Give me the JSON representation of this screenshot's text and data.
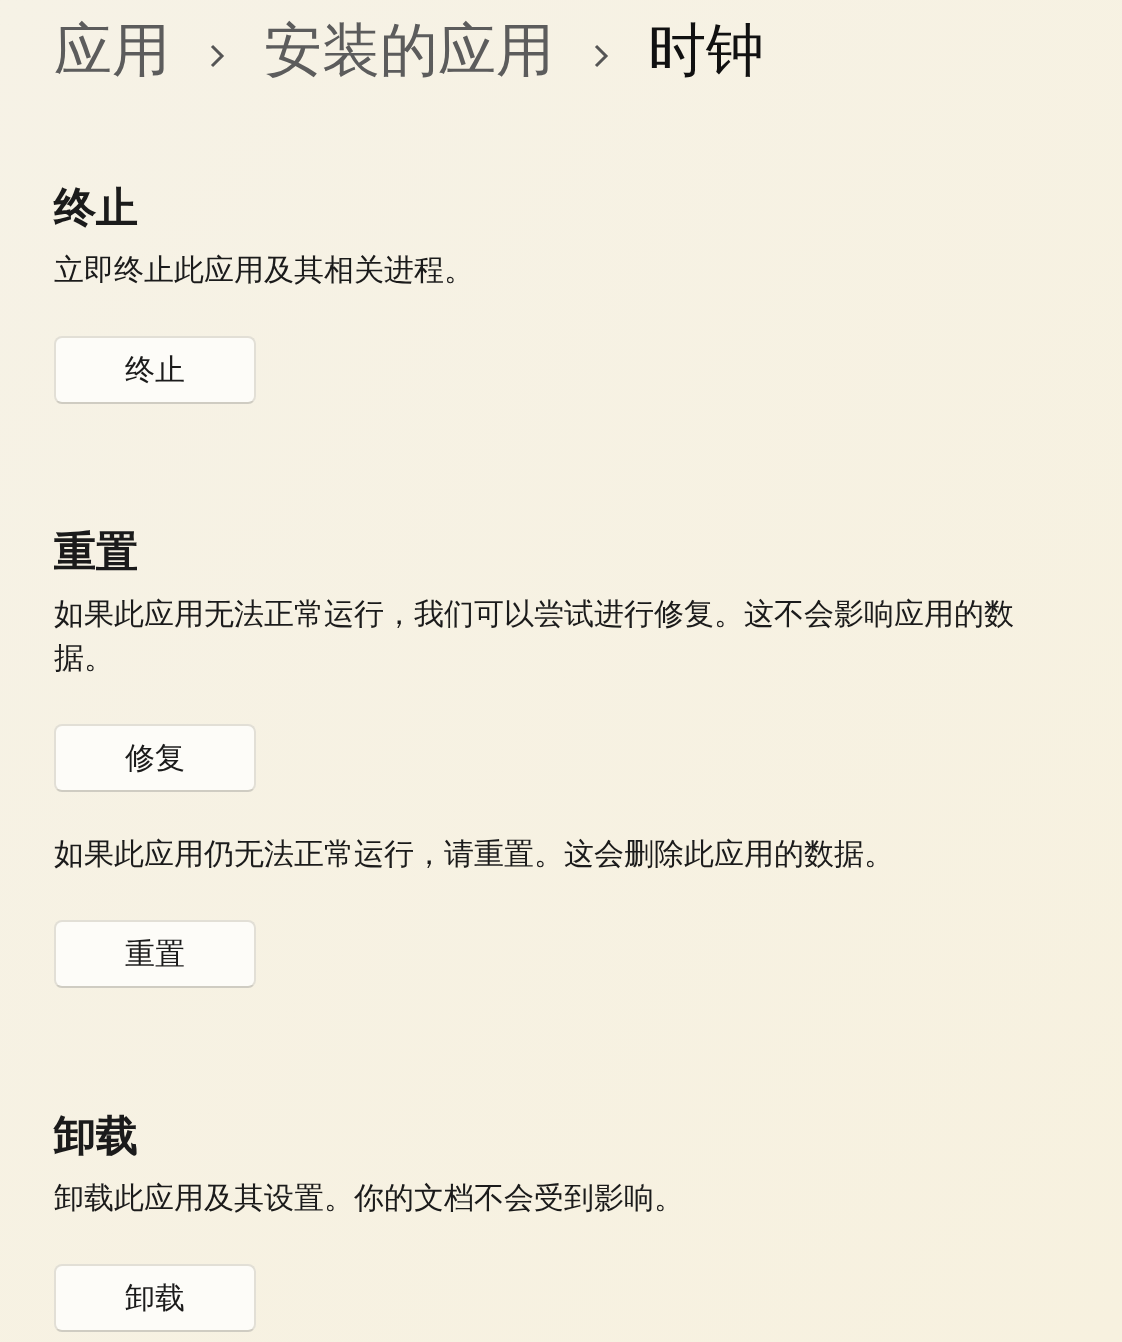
{
  "breadcrumb": [
    {
      "label": "应用",
      "current": false
    },
    {
      "label": "安装的应用",
      "current": false
    },
    {
      "label": "时钟",
      "current": true
    }
  ],
  "sections": [
    {
      "title": "终止",
      "items": [
        {
          "kind": "text",
          "text": "立即终止此应用及其相关进程。"
        },
        {
          "kind": "button",
          "label": "终止"
        }
      ]
    },
    {
      "title": "重置",
      "items": [
        {
          "kind": "text",
          "text": "如果此应用无法正常运行，我们可以尝试进行修复。这不会影响应用的数据。"
        },
        {
          "kind": "button",
          "label": "修复"
        },
        {
          "kind": "text",
          "text": "如果此应用仍无法正常运行，请重置。这会删除此应用的数据。"
        },
        {
          "kind": "button",
          "label": "重置"
        }
      ]
    },
    {
      "title": "卸载",
      "items": [
        {
          "kind": "text",
          "text": "卸载此应用及其设置。你的文档不会受到影响。"
        },
        {
          "kind": "button",
          "label": "卸载"
        }
      ]
    }
  ]
}
